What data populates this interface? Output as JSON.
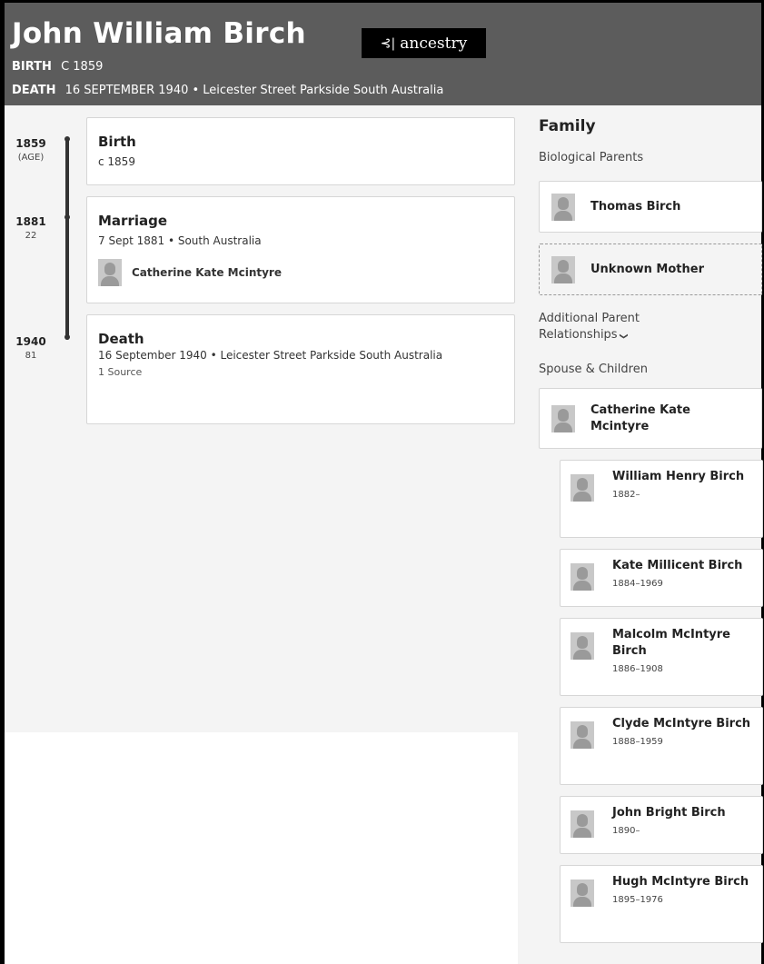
{
  "person": {
    "name": "John William Birch",
    "birth_label": "BIRTH",
    "birth_value": "C 1859",
    "death_label": "DEATH",
    "death_value": "16 SEPTEMBER 1940 • Leicester Street Parkside South Australia"
  },
  "logo": {
    "text": "ancestry",
    "icon": "leaf-icon"
  },
  "timeline": {
    "events": [
      {
        "year": "1859",
        "age": "(AGE)",
        "title": "Birth",
        "details": "c 1859"
      },
      {
        "year": "1881",
        "age": "22",
        "title": "Marriage",
        "details": "7 Sept 1881 • South Australia",
        "person": "Catherine Kate Mcintyre"
      },
      {
        "year": "1940",
        "age": "81",
        "title": "Death",
        "details": "16 September 1940 • Leicester Street Parkside South Australia",
        "sources": "1 Source"
      }
    ]
  },
  "family": {
    "title": "Family",
    "parents_label": "Biological Parents",
    "father": "Thomas Birch",
    "mother": "Unknown Mother",
    "additional_label": "Additional Parent Relationships",
    "spouse_label": "Spouse & Children",
    "spouse": "Catherine Kate Mcintyre",
    "children": [
      {
        "name": "William Henry Birch",
        "years": "1882–"
      },
      {
        "name": "Kate Millicent Birch",
        "years": "1884–1969"
      },
      {
        "name": "Malcolm McIntyre Birch",
        "years": "1886–1908"
      },
      {
        "name": "Clyde McIntyre Birch",
        "years": "1888–1959"
      },
      {
        "name": "John Bright Birch",
        "years": "1890–"
      },
      {
        "name": "Hugh McIntyre Birch",
        "years": "1895–1976"
      }
    ]
  },
  "colors": {
    "header_bg": "#5c5c5c",
    "panel_bg": "#f4f4f4",
    "logo_bg": "#000000"
  }
}
